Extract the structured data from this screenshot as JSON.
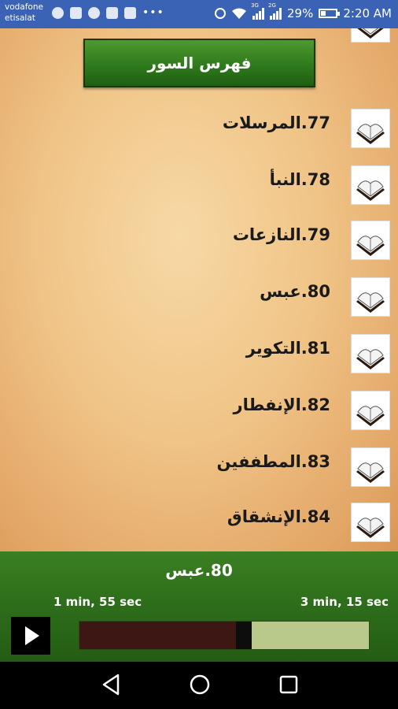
{
  "status_bar": {
    "carrier_line1": "vodafone",
    "carrier_line2": "etisalat",
    "network1": "3G",
    "network2": "2G",
    "battery": "29%",
    "time": "2:20 AM"
  },
  "header": {
    "title": "فهرس السور"
  },
  "surahs": [
    {
      "label": "77.المرسلات"
    },
    {
      "label": "78.النبأ"
    },
    {
      "label": "79.النازعات"
    },
    {
      "label": "80.عبس"
    },
    {
      "label": "81.التكوير"
    },
    {
      "label": "82.الإنفطار"
    },
    {
      "label": "83.المطففين"
    },
    {
      "label": "84.الإنشقاق"
    }
  ],
  "player": {
    "now_playing": "80.عبس",
    "elapsed": "1 min, 55 sec",
    "total": "3 min, 15 sec",
    "progress_fraction": 0.59
  },
  "colors": {
    "status_bar": "#3a63b5",
    "player_green": "#2d6d1a",
    "progress_played": "#3c1714",
    "progress_remaining": "#b8c98b"
  }
}
